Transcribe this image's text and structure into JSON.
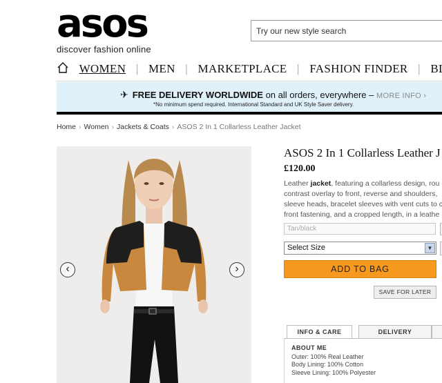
{
  "header": {
    "logo_text": "asos",
    "tagline": "discover fashion online",
    "search_placeholder": "Try our new style search"
  },
  "nav": {
    "items": [
      "WOMEN",
      "MEN",
      "MARKETPLACE",
      "FASHION FINDER",
      "BLOG"
    ],
    "active": "WOMEN"
  },
  "banner": {
    "headline_bold": "FREE DELIVERY WORLDWIDE",
    "headline_rest": " on all orders, everywhere – ",
    "more_link": "MORE INFO ›",
    "subline": "*No minimum spend required. International Standard and UK Style Saver delivery."
  },
  "breadcrumb": {
    "items": [
      "Home",
      "Women",
      "Jackets & Coats"
    ],
    "current": "ASOS 2 In 1 Collarless Leather Jacket",
    "separator": "›"
  },
  "product": {
    "title": "ASOS 2 In 1 Collarless Leather J",
    "price": "£120.00",
    "desc_lead": "Leather ",
    "desc_keyword": "jacket",
    "desc_line1": ", featuring a collarless design, rou",
    "desc_line2": "contrast overlay to front, reverse and shoulders,",
    "desc_line3": "sleeve heads, bracelet sleeves with vent cuts to c",
    "desc_line4": "front fastening, and a cropped length, in a leathe",
    "colour": "Tan/black",
    "size_select": "Select Size",
    "add_to_bag": "ADD TO BAG",
    "save_for_later": "SAVE FOR LATER"
  },
  "tabs": {
    "info": "INFO & CARE",
    "delivery": "DELIVERY"
  },
  "about": {
    "heading": "ABOUT ME",
    "lines": [
      "Outer: 100% Real Leather",
      "Body Lining: 100% Cotton",
      "Sleeve Lining: 100% Polyester"
    ]
  },
  "colors": {
    "banner_bg": "#e0f1f9",
    "add_to_bag": "#f7991e",
    "jacket_tan": "#c8893f",
    "jacket_black": "#1e1e1e"
  }
}
